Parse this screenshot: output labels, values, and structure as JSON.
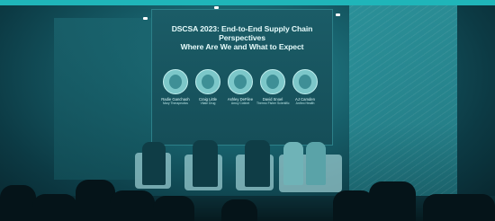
{
  "screen": {
    "title_line1": "DSCSA 2023: End-to-End Supply Chain Perspectives",
    "title_line2": "Where Are We and What to Expect"
  },
  "speakers": [
    {
      "name": "Radie Ganchaoh",
      "org": "Mary Therapeutics"
    },
    {
      "name": "Craig Little",
      "org": "Vitale Drug"
    },
    {
      "name": "Ashley DeFilee",
      "org": "Amcy Cotinet"
    },
    {
      "name": "David Snoel",
      "org": "Thermo Fisher Scientific"
    },
    {
      "name": "AJ Camden",
      "org": "Anthro Health"
    }
  ],
  "colors": {
    "accent": "#1fb5b9",
    "tint": "#17606b"
  }
}
